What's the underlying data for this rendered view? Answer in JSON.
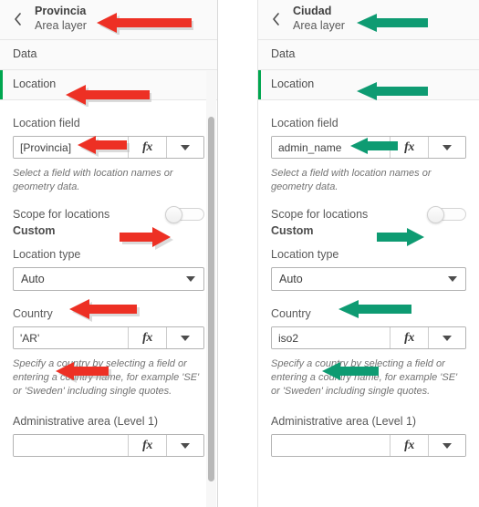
{
  "colors": {
    "accent_green": "#00a64f",
    "arrow_red": "#ed3024",
    "arrow_teal": "#00a municipal"
  },
  "panels": [
    {
      "id": "provincia",
      "header": {
        "back_icon": "chevron-left-icon",
        "title": "Provincia",
        "subtitle": "Area layer"
      },
      "sections": [
        {
          "label": "Data",
          "active": false
        },
        {
          "label": "Location",
          "active": true
        }
      ],
      "properties": {
        "location_field": {
          "label": "Location field",
          "value": "[Provincia]",
          "placeholder": "",
          "fx_label": "fx",
          "dropdown_icon": "chevron-down-icon",
          "help": "Select a field with location names or geometry data."
        },
        "scope": {
          "label": "Scope for locations",
          "value": "Custom",
          "toggle_state": "off"
        },
        "location_type": {
          "label": "Location type",
          "value": "Auto",
          "dropdown_icon": "chevron-down-icon"
        },
        "country": {
          "label": "Country",
          "value": "'AR'",
          "placeholder": "",
          "fx_label": "fx",
          "dropdown_icon": "chevron-down-icon",
          "help": "Specify a country by selecting a field or entering a country name, for example 'SE' or 'Sweden' including single quotes."
        },
        "admin_area": {
          "label": "Administrative area (Level 1)",
          "value": "",
          "placeholder": "",
          "fx_label": "fx",
          "dropdown_icon": "chevron-down-icon"
        }
      },
      "scrollbar": {
        "visible": true
      }
    },
    {
      "id": "ciudad",
      "header": {
        "back_icon": "chevron-left-icon",
        "title": "Ciudad",
        "subtitle": "Area layer"
      },
      "sections": [
        {
          "label": "Data",
          "active": false
        },
        {
          "label": "Location",
          "active": true
        }
      ],
      "properties": {
        "location_field": {
          "label": "Location field",
          "value": "admin_name",
          "placeholder": "",
          "fx_label": "fx",
          "dropdown_icon": "chevron-down-icon",
          "help": "Select a field with location names or geometry data."
        },
        "scope": {
          "label": "Scope for locations",
          "value": "Custom",
          "toggle_state": "off"
        },
        "location_type": {
          "label": "Location type",
          "value": "Auto",
          "dropdown_icon": "chevron-down-icon"
        },
        "country": {
          "label": "Country",
          "value": "iso2",
          "placeholder": "",
          "fx_label": "fx",
          "dropdown_icon": "chevron-down-icon",
          "help": "Specify a country by selecting a field or entering a country name, for example 'SE' or 'Sweden' including single quotes."
        },
        "admin_area": {
          "label": "Administrative area (Level 1)",
          "value": "",
          "placeholder": "",
          "fx_label": "fx",
          "dropdown_icon": "chevron-down-icon"
        }
      },
      "scrollbar": {
        "visible": false
      }
    }
  ],
  "annotations": {
    "left_color": "#ed3024",
    "right_color": "#0e9b72",
    "left_arrows": [
      {
        "target": "header-title",
        "direction": "left"
      },
      {
        "target": "section-location",
        "direction": "left"
      },
      {
        "target": "location-field-input",
        "direction": "left"
      },
      {
        "target": "scope-toggle",
        "direction": "right"
      },
      {
        "target": "location-type-select",
        "direction": "left"
      },
      {
        "target": "country-input",
        "direction": "left"
      }
    ],
    "right_arrows": [
      {
        "target": "header-title",
        "direction": "left"
      },
      {
        "target": "section-location",
        "direction": "left"
      },
      {
        "target": "location-field-input",
        "direction": "left"
      },
      {
        "target": "scope-toggle",
        "direction": "right"
      },
      {
        "target": "location-type-select",
        "direction": "left"
      },
      {
        "target": "country-input",
        "direction": "left"
      }
    ]
  }
}
